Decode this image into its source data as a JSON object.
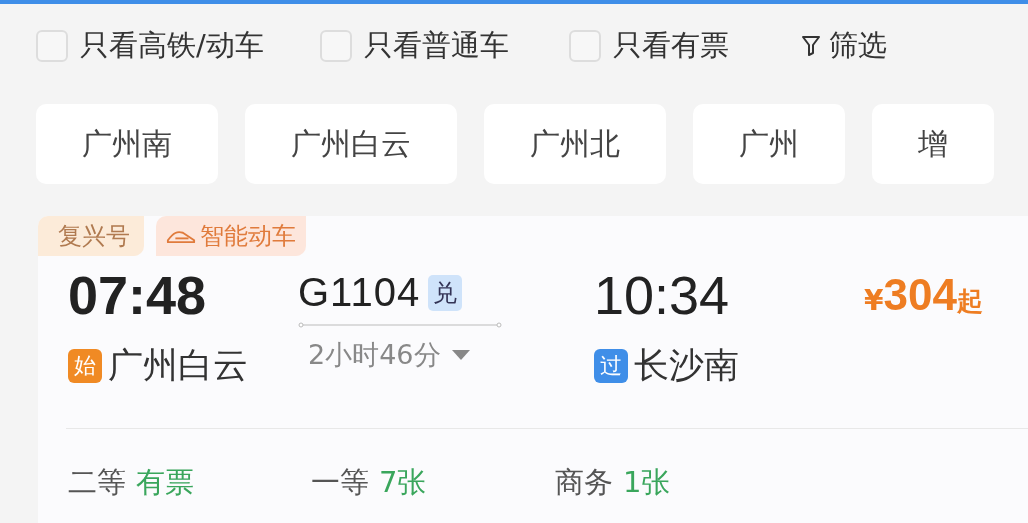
{
  "filters": [
    {
      "label": "只看高铁/动车",
      "checked": false
    },
    {
      "label": "只看普通车",
      "checked": false
    },
    {
      "label": "只看有票",
      "checked": false
    }
  ],
  "filter_button": {
    "label": "筛选"
  },
  "stations": [
    {
      "label": "广州南",
      "selected": false
    },
    {
      "label": "广州白云",
      "selected": false
    },
    {
      "label": "广州北",
      "selected": false
    },
    {
      "label": "广州",
      "selected": false
    },
    {
      "label": "增",
      "selected": false
    }
  ],
  "train": {
    "tags": [
      {
        "kind": "brand",
        "label": "复兴号"
      },
      {
        "kind": "smart",
        "label": "智能动车"
      }
    ],
    "depart_time": "07:48",
    "number": "G1104",
    "exchange_badge": "兑",
    "arrive_time": "10:34",
    "price": {
      "currency": "¥",
      "amount": "304",
      "suffix": "起"
    },
    "depart_station": {
      "kind": "start",
      "badge": "始",
      "name": "广州白云"
    },
    "duration": "2小时46分",
    "arrive_station": {
      "kind": "pass",
      "badge": "过",
      "name": "长沙南"
    },
    "seats": [
      {
        "name": "二等",
        "availability": "有票"
      },
      {
        "name": "一等",
        "availability": "7张"
      },
      {
        "name": "商务",
        "availability": "1张"
      }
    ]
  }
}
